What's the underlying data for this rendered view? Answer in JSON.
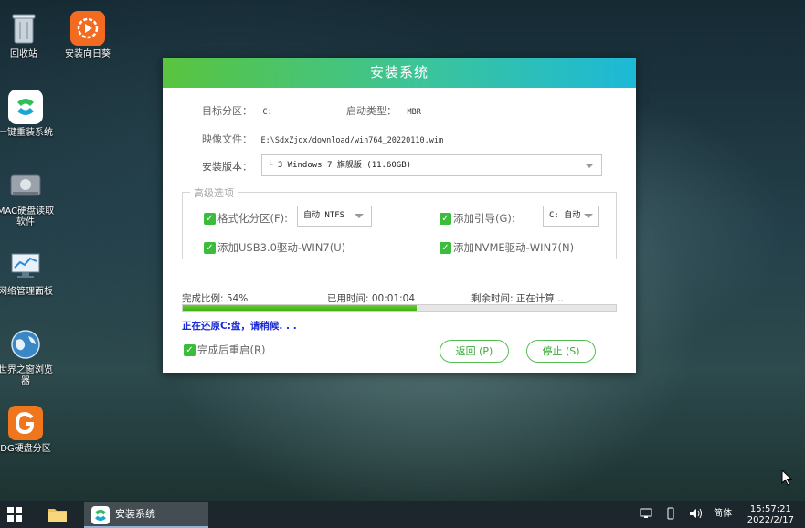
{
  "desktop": {
    "icons": [
      {
        "label": "回收站"
      },
      {
        "label": "安装向日葵"
      },
      {
        "label": "一键重装系统"
      },
      {
        "label": "MAC硬盘读取软件"
      },
      {
        "label": "网络管理面板"
      },
      {
        "label": "世界之窗浏览器"
      },
      {
        "label": "DG硬盘分区"
      }
    ]
  },
  "installer": {
    "title": "安装系统",
    "target_label": "目标分区：",
    "target_value": "C:",
    "boot_type_label": "启动类型：",
    "boot_type_value": "MBR",
    "image_label": "映像文件：",
    "image_value": "E:\\SdxZjdx/download/win764_20220110.wim",
    "edition_label": "安装版本：",
    "edition_value": "└ 3 Windows 7 旗舰版 (11.60GB)",
    "advanced_label": "高级选项",
    "format_label": "格式化分区(F):",
    "format_value": "自动 NTFS",
    "bootloader_label": "添加引导(G):",
    "bootloader_value": "C: 自动",
    "usb3_label": "添加USB3.0驱动-WIN7(U)",
    "nvme_label": "添加NVME驱动-WIN7(N)",
    "progress_label": "完成比例: 54%",
    "progress_percent": 54,
    "elapsed_label": "已用时间: 00:01:04",
    "remaining_label": "剩余时间: 正在计算...",
    "status_text": "正在还原C:盘，请稍候. . .",
    "reboot_label": "完成后重启(R)",
    "back_button": "返回 (P)",
    "stop_button": "停止 (S)"
  },
  "taskbar": {
    "active_app": "安装系统",
    "ime": "简体",
    "time": "15:57:21",
    "date": "2022/2/17"
  },
  "colors": {
    "accent_green": "#3bbd3b",
    "status_blue": "#1a2ad6"
  }
}
